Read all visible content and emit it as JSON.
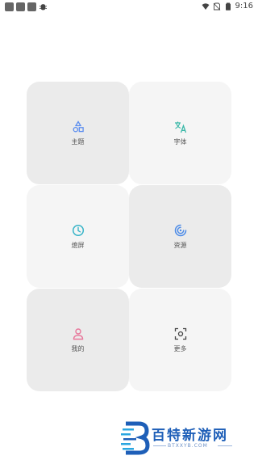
{
  "status_bar": {
    "left_icons": [
      "notification-square",
      "notification-square",
      "notification-square",
      "bug-icon"
    ],
    "right_icons": [
      "wifi-icon",
      "no-sim-icon",
      "battery-icon"
    ],
    "time": "9:16"
  },
  "tiles": [
    {
      "label": "主题",
      "icon": "shapes-icon",
      "color": "#5b8def"
    },
    {
      "label": "字体",
      "icon": "translate-icon",
      "color": "#3ab8a8"
    },
    {
      "label": "熄屏",
      "icon": "clock-icon",
      "color": "#38b4c8"
    },
    {
      "label": "资源",
      "icon": "swirl-icon",
      "color": "#4a8ae8"
    },
    {
      "label": "我的",
      "icon": "person-icon",
      "color": "#e8769a"
    },
    {
      "label": "更多",
      "icon": "focus-icon",
      "color": "#444444"
    }
  ],
  "watermark": {
    "title": "百特新游网",
    "subtitle": "BTXXYB.COM"
  }
}
